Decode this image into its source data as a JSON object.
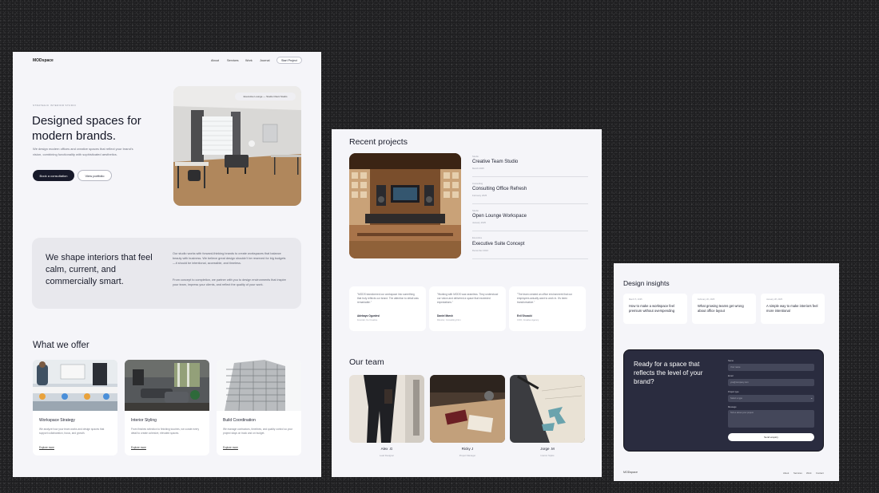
{
  "page1": {
    "nav": {
      "logo": "MODspace",
      "links": [
        "About",
        "Services",
        "Work",
        "Journal"
      ],
      "cta": "Start Project"
    },
    "hero": {
      "eyebrow": "Strategic interior studio",
      "title": "Designed spaces for modern brands.",
      "subtitle": "We design modern offices and creative spaces that reflect your brand's vision, combining functionality with sophisticated aesthetics.",
      "primary_button": "Book a consultation",
      "secondary_button": "View portfolio",
      "image_chip": "Executive Lounge — Studio Client Studio"
    },
    "about": {
      "title": "We shape interiors that feel calm, current, and commercially smart.",
      "paragraph1": "Our studio works with forward-thinking brands to create workspaces that balance beauty with business. We believe great design shouldn't be reserved for big budgets—it should be intentional, accessible, and timeless.",
      "paragraph2": "From concept to completion, we partner with you to design environments that inspire your team, impress your clients, and reflect the quality of your work."
    },
    "offer": {
      "title": "What we offer",
      "cards": [
        {
          "title": "Workspace Strategy",
          "text": "We analyze how your team works and design spaces that support collaboration, focus, and growth.",
          "link": "Explore more"
        },
        {
          "title": "Interior Styling",
          "text": "From finishes selection to finishing touches, we curate every detail to create cohesive, elevated spaces.",
          "link": "Explore more"
        },
        {
          "title": "Build Coordination",
          "text": "We manage contractors, timelines, and quality control so your project stays on track and on budget.",
          "link": "Explore more"
        }
      ]
    }
  },
  "page2": {
    "projects_title": "Recent projects",
    "projects": [
      {
        "category": "Studio",
        "name": "Creative Team Studio",
        "date": "March 2025"
      },
      {
        "category": "Consulting",
        "name": "Consulting Office Refresh",
        "date": "February 2025"
      },
      {
        "category": "Studio",
        "name": "Open Lounge Workspace",
        "date": "January 2025"
      },
      {
        "category": "Executive",
        "name": "Executive Suite Concept",
        "date": "December 2024"
      }
    ],
    "testimonials": [
      {
        "text": "\"MODS transformed our workspace into something that truly reflects our brand. The attention to detail was remarkable.\"",
        "name": "Adebayo Ogunlesi",
        "role": "Founder, Fe Creative"
      },
      {
        "text": "\"Working with MODS was seamless. They understood our vision and delivered a space that exceeded expectations.\"",
        "name": "Daniel Marsh",
        "role": "Director, Consulting Firm"
      },
      {
        "text": "\"The team created an office environment that our employees actually want to work in. It's been transformative.\"",
        "name": "Evil Shozuki",
        "role": "COO, Creative Agency"
      }
    ],
    "team_title": "Our team",
    "team": [
      {
        "name": "Alex .G",
        "role": "Lead Designer"
      },
      {
        "name": "Ricky J",
        "role": "Project Manager"
      },
      {
        "name": "Jorge .M",
        "role": "Interior Stylist"
      }
    ]
  },
  "page3": {
    "insights_title": "Design insights",
    "insights": [
      {
        "date": "March 5, 2025",
        "title": "How to make a workspace feel premium without overspending"
      },
      {
        "date": "February 20, 2025",
        "title": "What growing teams get wrong about office layout"
      },
      {
        "date": "January 28, 2025",
        "title": "A simple way to make interiors feel more intentional"
      }
    ],
    "cta": {
      "title": "Ready for a space that reflects the level of your brand?",
      "fields": [
        {
          "label": "Name",
          "placeholder": "Your name"
        },
        {
          "label": "Email",
          "placeholder": "you@company.com"
        },
        {
          "label": "Project type",
          "placeholder": "Select a type"
        },
        {
          "label": "Message",
          "placeholder": "Tell us about your project"
        }
      ],
      "button": "Send enquiry"
    },
    "footer": {
      "logo": "MODspace",
      "links": [
        "About",
        "Services",
        "Work",
        "Contact"
      ]
    }
  }
}
